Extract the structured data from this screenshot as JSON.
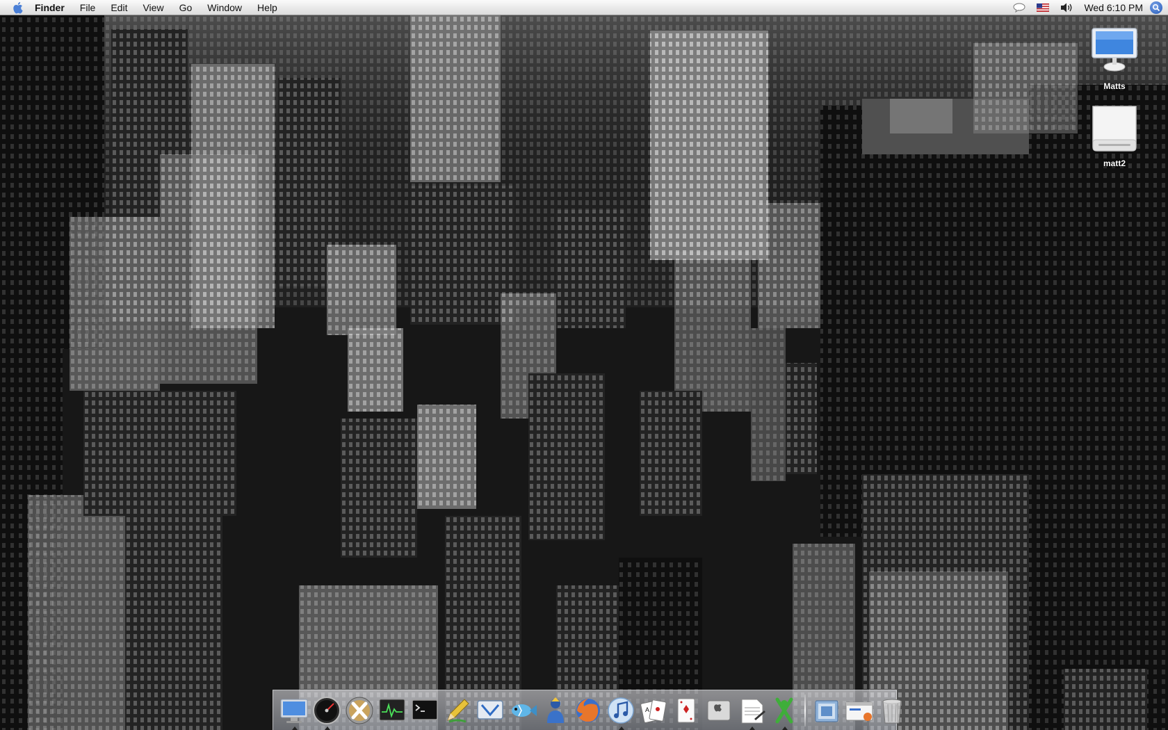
{
  "menubar": {
    "app_name": "Finder",
    "menus": [
      "File",
      "Edit",
      "View",
      "Go",
      "Window",
      "Help"
    ],
    "status_icons": [
      "speech-bubble-icon",
      "us-flag-icon",
      "volume-icon"
    ],
    "clock": "Wed 6:10 PM",
    "spotlight": "spotlight-icon"
  },
  "desktop_icons": [
    {
      "label": "Matts",
      "icon": "imac-display-icon"
    },
    {
      "label": "matt2",
      "icon": "external-drive-icon"
    }
  ],
  "dock": {
    "apps": [
      {
        "name": "finder-display-icon",
        "running": true
      },
      {
        "name": "dashboard-gauge-icon",
        "running": true
      },
      {
        "name": "mac-os-x-icon",
        "running": false
      },
      {
        "name": "activity-monitor-icon",
        "running": false
      },
      {
        "name": "terminal-icon",
        "running": false
      },
      {
        "name": "pencil-app-icon",
        "running": false
      },
      {
        "name": "vlc-screen-icon",
        "running": false
      },
      {
        "name": "fish-icon",
        "running": false
      },
      {
        "name": "person-figure-icon",
        "running": false
      },
      {
        "name": "firefox-icon",
        "running": false
      },
      {
        "name": "itunes-icon",
        "running": true
      },
      {
        "name": "playing-cards-icon",
        "running": false
      },
      {
        "name": "card-deck-icon",
        "running": false
      },
      {
        "name": "system-preferences-icon",
        "running": false
      },
      {
        "name": "text-document-icon",
        "running": true
      },
      {
        "name": "x11-icon",
        "running": true
      }
    ],
    "docs": [
      {
        "name": "folder-stack-icon"
      },
      {
        "name": "browser-window-icon"
      },
      {
        "name": "trash-icon"
      }
    ]
  },
  "colors": {
    "menubar_top": "#fbfbfb",
    "menubar_bottom": "#dcdcdc",
    "apple_blue": "#4a7fd6"
  }
}
